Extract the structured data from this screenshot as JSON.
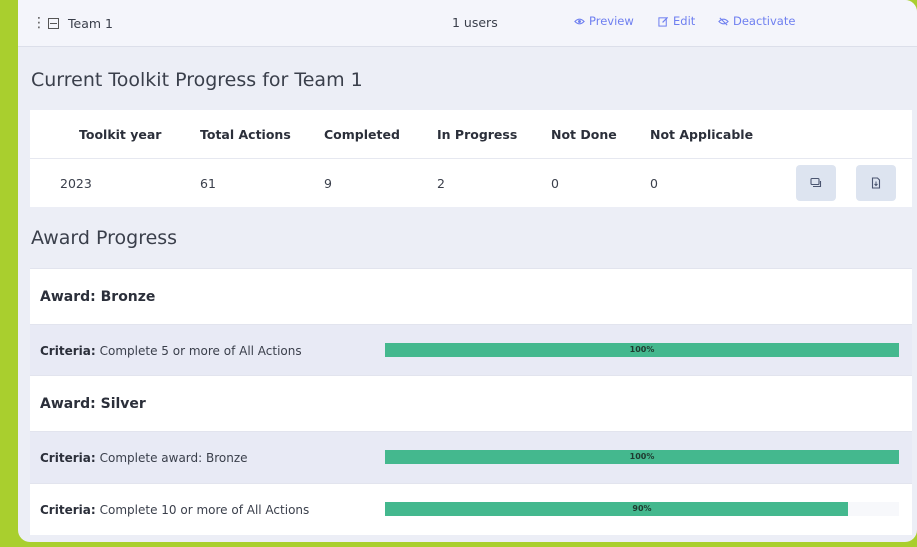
{
  "team_row": {
    "team_name": "Team 1",
    "user_count": "1 users",
    "actions": {
      "preview": "Preview",
      "edit": "Edit",
      "deactivate": "Deactivate"
    }
  },
  "toolkit": {
    "title": "Current Toolkit Progress for Team 1",
    "columns": [
      "Toolkit year",
      "Total Actions",
      "Completed",
      "In Progress",
      "Not Done",
      "Not Applicable"
    ],
    "rows": [
      {
        "year": "2023",
        "total": "61",
        "completed": "9",
        "in_progress": "2",
        "not_done": "0",
        "not_applicable": "0"
      }
    ]
  },
  "awards": {
    "title": "Award Progress",
    "criteria_label": "Criteria:",
    "items": [
      {
        "name": "Award: Bronze",
        "criteria": [
          {
            "text": "Complete 5 or more of All Actions",
            "progress": 100,
            "progress_label": "100%"
          }
        ]
      },
      {
        "name": "Award: Silver",
        "criteria": [
          {
            "text": "Complete award: Bronze",
            "progress": 100,
            "progress_label": "100%"
          },
          {
            "text": "Complete 10 or more of All Actions",
            "progress": 90,
            "progress_label": "90%"
          }
        ]
      }
    ]
  },
  "colors": {
    "accent": "#6e7ff0",
    "progress": "#44b88e",
    "background": "#a9cf2e"
  }
}
